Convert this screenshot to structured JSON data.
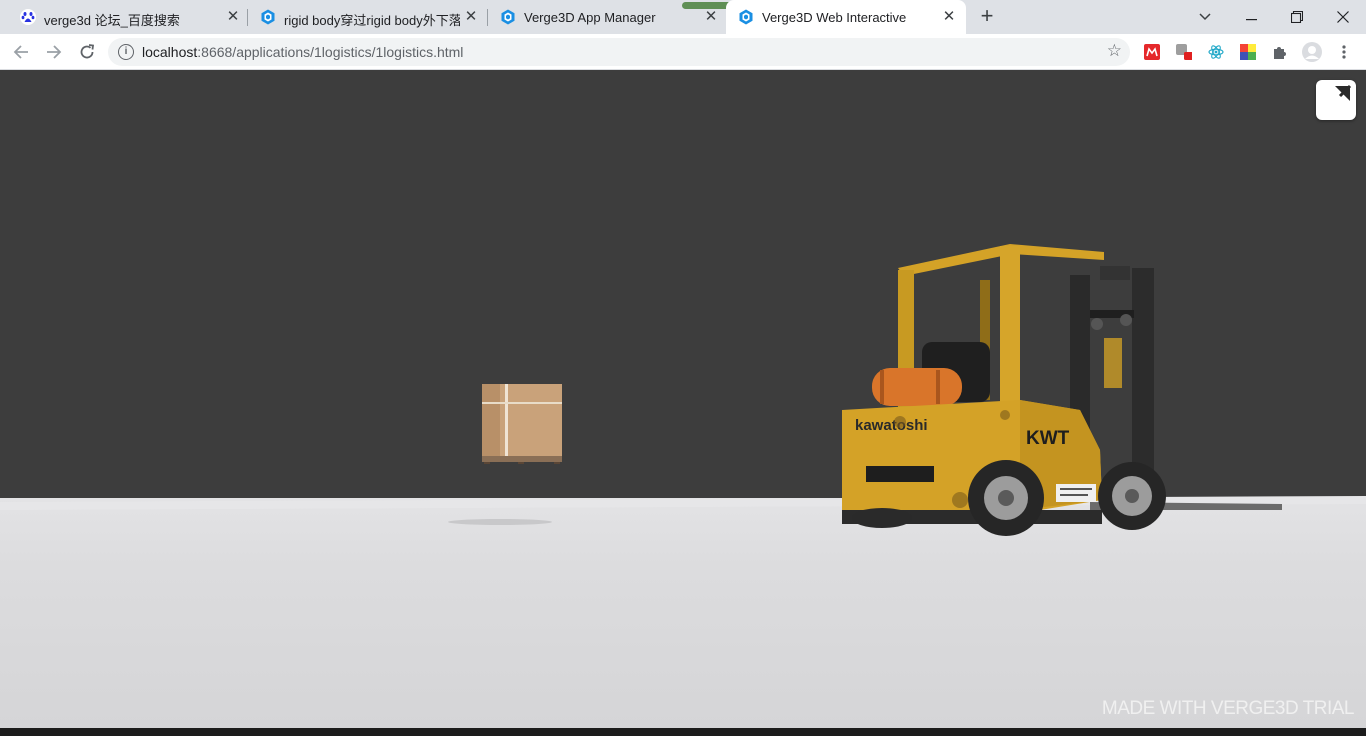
{
  "tabs": [
    {
      "title": "verge3d 论坛_百度搜索",
      "favicon": "baidu-paw-icon",
      "active": false
    },
    {
      "title": "rigid body穿过rigid body外下落",
      "favicon": "verge3d-icon",
      "active": false
    },
    {
      "title": "Verge3D App Manager",
      "favicon": "verge3d-icon",
      "active": false
    },
    {
      "title": "Verge3D Web Interactive",
      "favicon": "verge3d-icon",
      "active": true
    }
  ],
  "toolbar": {
    "url_host": "localhost",
    "url_path": ":8668/applications/1logistics/1logistics.html"
  },
  "scene": {
    "forklift_brand": "kawatoshi",
    "forklift_logo": "KWT",
    "watermark": "MADE WITH VERGE3D TRIAL"
  },
  "colors": {
    "sky": "#3d3d3d",
    "floor": "#dcdcde",
    "forklift_yellow": "#d4a227",
    "box": "#c9a27a"
  }
}
